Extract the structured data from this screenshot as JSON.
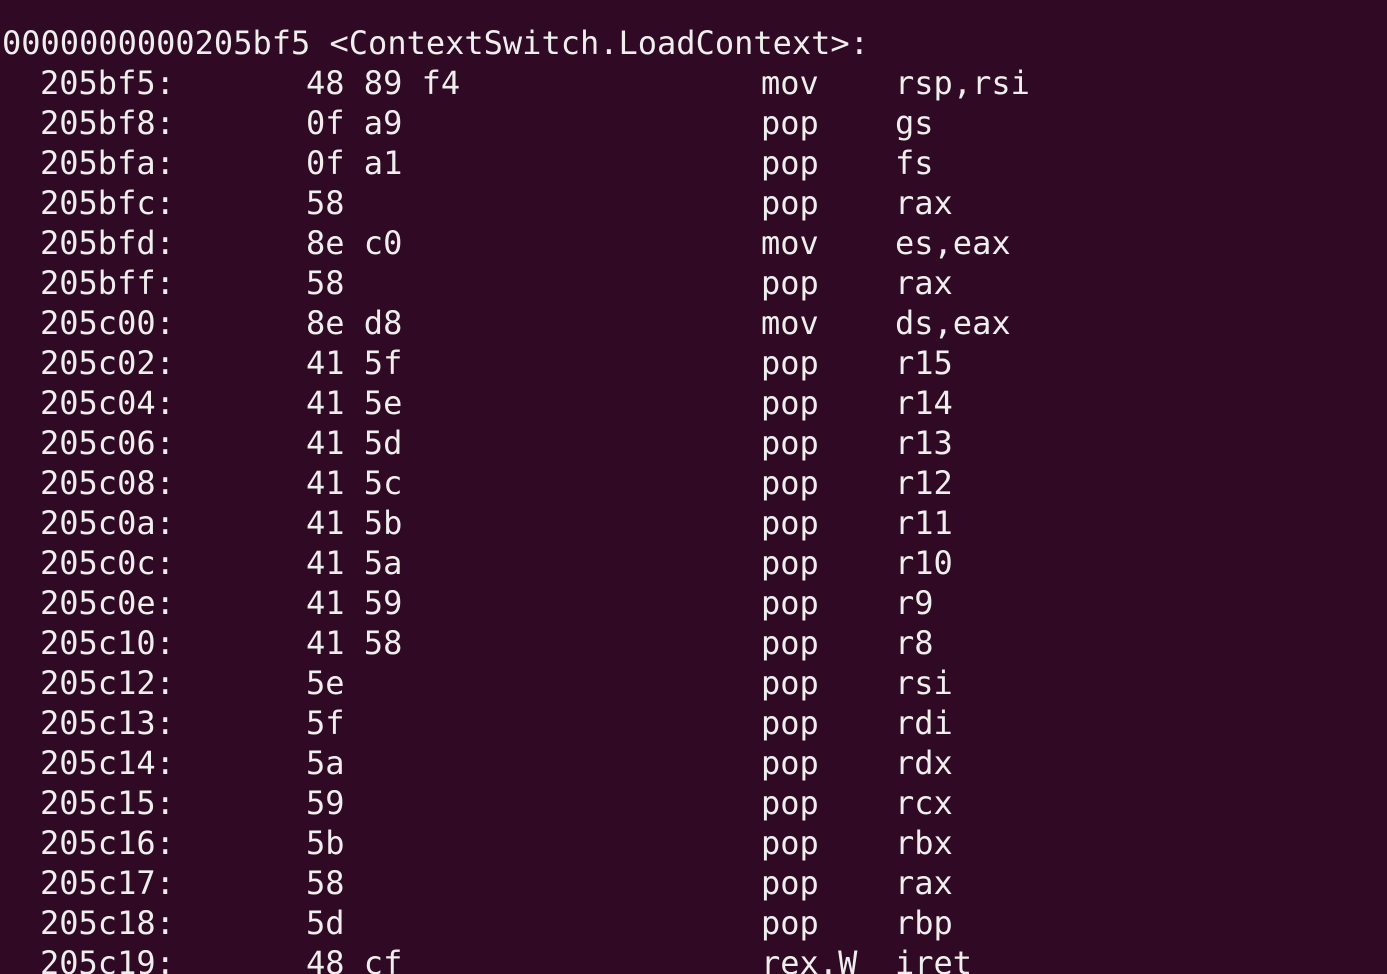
{
  "terminal": {
    "header": "0000000000205bf5 <ContextSwitch.LoadContext>:",
    "rows": [
      {
        "addr": "205bf5:",
        "bytes": "48 89 f4",
        "mnemonic": "mov",
        "operands": "rsp,rsi"
      },
      {
        "addr": "205bf8:",
        "bytes": "0f a9",
        "mnemonic": "pop",
        "operands": "gs"
      },
      {
        "addr": "205bfa:",
        "bytes": "0f a1",
        "mnemonic": "pop",
        "operands": "fs"
      },
      {
        "addr": "205bfc:",
        "bytes": "58",
        "mnemonic": "pop",
        "operands": "rax"
      },
      {
        "addr": "205bfd:",
        "bytes": "8e c0",
        "mnemonic": "mov",
        "operands": "es,eax"
      },
      {
        "addr": "205bff:",
        "bytes": "58",
        "mnemonic": "pop",
        "operands": "rax"
      },
      {
        "addr": "205c00:",
        "bytes": "8e d8",
        "mnemonic": "mov",
        "operands": "ds,eax"
      },
      {
        "addr": "205c02:",
        "bytes": "41 5f",
        "mnemonic": "pop",
        "operands": "r15"
      },
      {
        "addr": "205c04:",
        "bytes": "41 5e",
        "mnemonic": "pop",
        "operands": "r14"
      },
      {
        "addr": "205c06:",
        "bytes": "41 5d",
        "mnemonic": "pop",
        "operands": "r13"
      },
      {
        "addr": "205c08:",
        "bytes": "41 5c",
        "mnemonic": "pop",
        "operands": "r12"
      },
      {
        "addr": "205c0a:",
        "bytes": "41 5b",
        "mnemonic": "pop",
        "operands": "r11"
      },
      {
        "addr": "205c0c:",
        "bytes": "41 5a",
        "mnemonic": "pop",
        "operands": "r10"
      },
      {
        "addr": "205c0e:",
        "bytes": "41 59",
        "mnemonic": "pop",
        "operands": "r9"
      },
      {
        "addr": "205c10:",
        "bytes": "41 58",
        "mnemonic": "pop",
        "operands": "r8"
      },
      {
        "addr": "205c12:",
        "bytes": "5e",
        "mnemonic": "pop",
        "operands": "rsi"
      },
      {
        "addr": "205c13:",
        "bytes": "5f",
        "mnemonic": "pop",
        "operands": "rdi"
      },
      {
        "addr": "205c14:",
        "bytes": "5a",
        "mnemonic": "pop",
        "operands": "rdx"
      },
      {
        "addr": "205c15:",
        "bytes": "59",
        "mnemonic": "pop",
        "operands": "rcx"
      },
      {
        "addr": "205c16:",
        "bytes": "5b",
        "mnemonic": "pop",
        "operands": "rbx"
      },
      {
        "addr": "205c17:",
        "bytes": "58",
        "mnemonic": "pop",
        "operands": "rax"
      },
      {
        "addr": "205c18:",
        "bytes": "5d",
        "mnemonic": "pop",
        "operands": "rbp"
      },
      {
        "addr": "205c19:",
        "bytes": "48 cf",
        "mnemonic": "rex.W",
        "operands": "iret"
      }
    ]
  },
  "colors": {
    "background": "#300a24",
    "foreground": "#eeeeec"
  }
}
